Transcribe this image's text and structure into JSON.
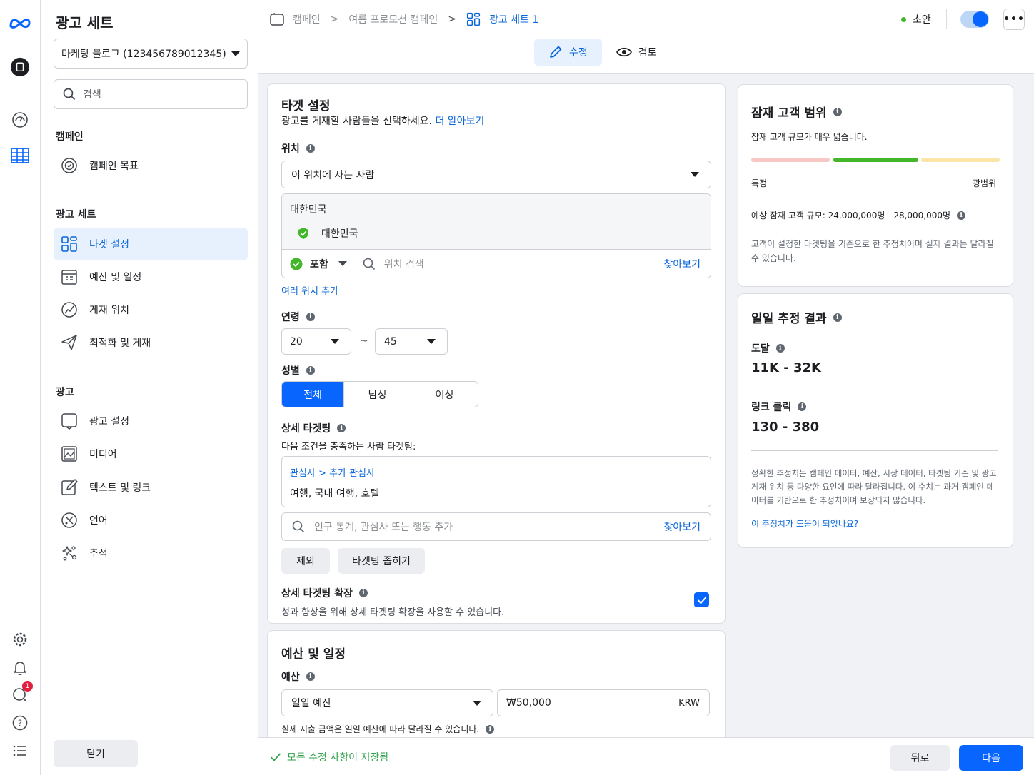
{
  "colors": {
    "accent": "#0866ff",
    "link": "#0a66d8",
    "success": "#31a24c",
    "active_bg": "#e7f1fd"
  },
  "sidebar": {
    "title": "광고 세트",
    "account": "마케팅 블로그 (123456789012345)",
    "search_placeholder": "검색",
    "sections": {
      "campaign": "캠페인",
      "adset": "광고 세트",
      "ad": "광고"
    },
    "campaign_items": [
      {
        "label": "캠페인 목표",
        "icon": "target-icon"
      }
    ],
    "adset_items": [
      {
        "label": "타겟 설정",
        "icon": "grid-icon",
        "active": true
      },
      {
        "label": "예산 및 일정",
        "icon": "calendar-icon"
      },
      {
        "label": "게재 위치",
        "icon": "placement-icon"
      },
      {
        "label": "최적화 및 게재",
        "icon": "send-icon"
      }
    ],
    "ad_items": [
      {
        "label": "광고 설정",
        "icon": "ad-icon"
      },
      {
        "label": "미디어",
        "icon": "media-icon"
      },
      {
        "label": "텍스트 및 링크",
        "icon": "edit-icon"
      },
      {
        "label": "언어",
        "icon": "language-icon"
      },
      {
        "label": "추적",
        "icon": "tracking-icon"
      }
    ],
    "close_label": "닫기"
  },
  "rail": {
    "notification_count": "1"
  },
  "header": {
    "breadcrumb": [
      "캠페인",
      "여름 프로모션 캠페인",
      "광고 세트 1"
    ],
    "status": "초안",
    "more": "•••",
    "tabs": [
      {
        "label": "수정",
        "active": true
      },
      {
        "label": "검토"
      }
    ]
  },
  "targeting": {
    "title": "타겟 설정",
    "subtitle": "광고를 게재할 사람들을 선택하세요.",
    "learn_more": "더 알아보기",
    "location_label": "위치",
    "location_select": "이 위치에 사는 사람",
    "country_header": "대한민국",
    "country_item": "대한민국",
    "include_label": "포함",
    "location_search_placeholder": "위치 검색",
    "browse": "찾아보기",
    "add_multiple": "여러 위치 추가",
    "age_label": "연령",
    "age_min": "20",
    "age_tilde": "~",
    "age_max": "45",
    "gender_label": "성별",
    "genders": [
      {
        "label": "전체",
        "active": true
      },
      {
        "label": "남성"
      },
      {
        "label": "여성"
      }
    ],
    "detailed_label": "상세 타겟팅",
    "detailed_desc": "다음 조건을 충족하는 사람 타겟팅:",
    "interest_path": "관심사 > 추가 관심사",
    "interest_values": "여행, 국내 여행, 호텔",
    "detailed_search_placeholder": "인구 통계, 관심사 또는 행동 추가",
    "exclude": "제외",
    "narrow": "타겟팅 좁히기",
    "expand_label": "상세 타겟팅 확장",
    "expand_desc": "성과 향상을 위해 상세 타겟팅 확장을 사용할 수 있습니다.",
    "expand_checked": true
  },
  "budget": {
    "title": "예산 및 일정",
    "label": "예산",
    "type": "일일 예산",
    "amount": "₩50,000",
    "currency": "KRW",
    "note": "실제 지출 금액은 일일 예산에 따라 달라질 수 있습니다."
  },
  "audience": {
    "title": "잠재 고객 범위",
    "desc": "잠재 고객 규모가 매우 넓습니다.",
    "specific": "특정",
    "broad": "광범위",
    "gauge_colors": [
      "#f8c9c4",
      "#42b72a",
      "#fbe6a8"
    ],
    "estimate": "예상 잠재 고객 규모: 24,000,000명 - 28,000,000명",
    "note": "고객이 설정한 타겟팅을 기준으로 한 추정치이며 실제 결과는 달라질 수 있습니다."
  },
  "daily": {
    "title": "일일 추정 결과",
    "reach_label": "도달",
    "reach_value": "11K - 32K",
    "clicks_label": "링크 클릭",
    "clicks_value": "130 - 380",
    "note": "정확한 추정치는 캠페인 데이터, 예산, 시장 데이터, 타겟팅 기준 및 광고 게재 위치 등 다양한 요인에 따라 달라집니다. 이 수치는 과거 캠페인 데이터를 기반으로 한 추정치이며 보장되지 않습니다.",
    "feedback": "이 추정치가 도움이 되었나요?"
  },
  "footer": {
    "saved": "모든 수정 사항이 저장됨",
    "back": "뒤로",
    "next": "다음"
  }
}
